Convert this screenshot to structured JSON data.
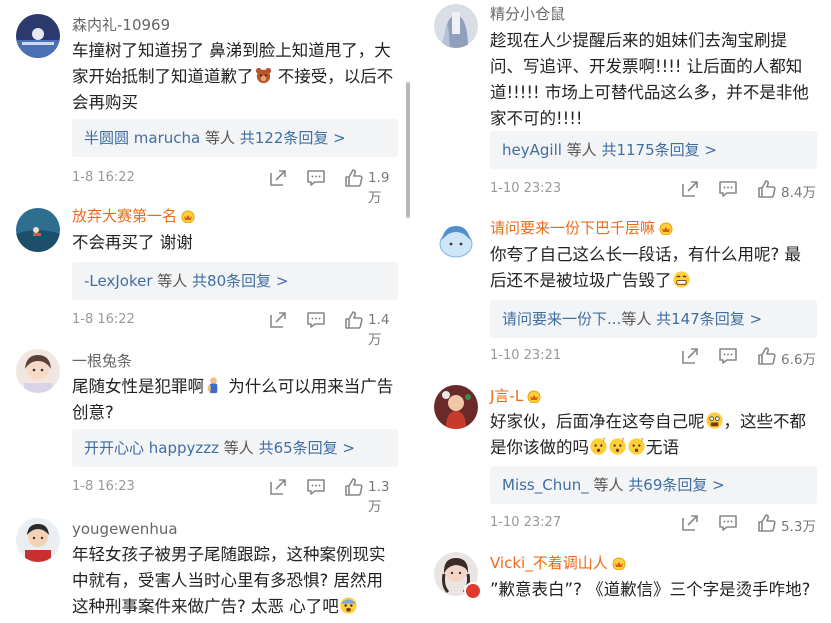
{
  "left": [
    {
      "user": "森内礼-10969",
      "name_style": "normal",
      "text": "车撞树了知道拐了 鼻涕到脸上知道甩了，大家开始抵制了知道道歉了",
      "text_tail": " 不接受，以后不会再购买",
      "reply_name": "半圆圆 marucha",
      "reply_mid": " 等人 ",
      "reply_count": "共122条回复 >",
      "date": "1-8 16:22",
      "likes": "1.9万"
    },
    {
      "user": "放弃大赛第一名",
      "name_style": "orange",
      "text": "不会再买了 谢谢",
      "reply_name": "-LexJoker",
      "reply_mid": " 等人 ",
      "reply_count": "共80条回复 >",
      "date": "1-8 16:22",
      "likes": "1.4万"
    },
    {
      "user": "一根兔条",
      "name_style": "normal",
      "text": "尾随女性是犯罪啊",
      "text_tail": " 为什么可以用来当广告创意?",
      "reply_name": "开开心心 happyzzz",
      "reply_mid": " 等人 ",
      "reply_count": "共65条回复 >",
      "date": "1-8 16:23",
      "likes": "1.3万"
    },
    {
      "user": "yougewenhua",
      "name_style": "normal",
      "text": "年轻女孩子被男子尾随跟踪，这种案例现实中就有，受害人当时心里有多恐惧? 居然用这种刑事案件来做广告? 太恶 心了吧"
    }
  ],
  "right": [
    {
      "user": "精分小仓鼠",
      "name_style": "normal",
      "text": "趁现在人少提醒后来的姐妹们去淘宝刷提问、写追评、开发票啊!!!! 让后面的人都知道!!!!! 市场上可替代品这么多，并不是非他家不可的!!!!",
      "reply_name": "heyAgill",
      "reply_mid": " 等人 ",
      "reply_count": "共1175条回复 >",
      "date": "1-10 23:23",
      "likes": "8.4万"
    },
    {
      "user": "请问要来一份下巴千层嘛",
      "name_style": "orange",
      "text": "你夸了自己这么长一段话，有什么用呢? 最后还不是被垃圾广告毁了",
      "reply_name": "请问要来一份下...",
      "reply_mid": "等人 ",
      "reply_count": "共147条回复 >",
      "date": "1-10 23:21",
      "likes": "6.6万"
    },
    {
      "user": "J言-L",
      "name_style": "orange",
      "text": "好家伙，后面净在这夸自己呢",
      "text_tail": "，这些不都是你该做的吗",
      "text_end": "无语",
      "reply_name": "Miss_Chun_",
      "reply_mid": " 等人 ",
      "reply_count": "共69条回复 >",
      "date": "1-10 23:27",
      "likes": "5.3万"
    },
    {
      "user": "Vicki_不着调山人",
      "name_style": "orange",
      "text": "”歉意表白”? 《道歉信》三个字是烫手咋地?"
    }
  ],
  "colors": {
    "orange_name": "#ee6a1b",
    "reply_link": "#3f6ea3",
    "meta": "#999999"
  },
  "icons": {
    "share": "share-icon",
    "comment": "comment-icon",
    "like": "thumbs-up-icon",
    "crown": "crown-badge-icon"
  }
}
